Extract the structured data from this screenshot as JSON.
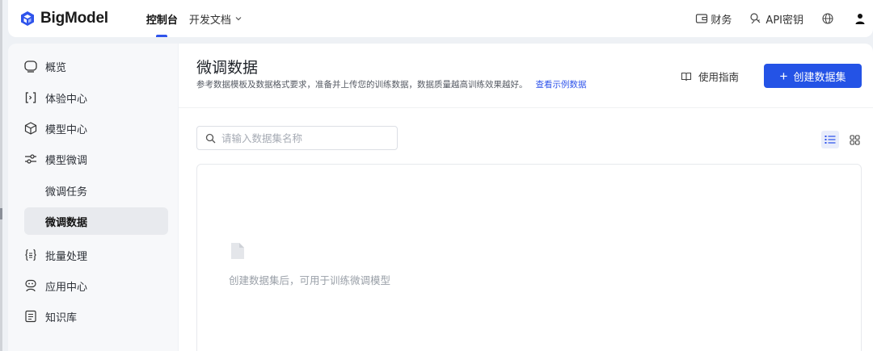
{
  "app": {
    "brand": "BigModel",
    "accent": "#2453e6"
  },
  "topnav": {
    "items": [
      {
        "label": "控制台",
        "active": true
      },
      {
        "label": "开发文档",
        "active": false,
        "dropdown": true
      }
    ],
    "right": {
      "finance": "财务",
      "apikey": "API密钥"
    }
  },
  "sidebar": {
    "items": [
      {
        "label": "概览",
        "icon": "chat-bubble-icon"
      },
      {
        "label": "体验中心",
        "icon": "bracket-icon"
      },
      {
        "label": "模型中心",
        "icon": "cube-icon"
      },
      {
        "label": "模型微调",
        "icon": "sliders-icon"
      },
      {
        "label": "批量处理",
        "icon": "braces-icon"
      },
      {
        "label": "应用中心",
        "icon": "robot-icon"
      },
      {
        "label": "知识库",
        "icon": "book-icon"
      }
    ],
    "subitems": [
      {
        "label": "微调任务",
        "active": false
      },
      {
        "label": "微调数据",
        "active": true
      }
    ]
  },
  "main": {
    "title": "微调数据",
    "description": "参考数据模板及数据格式要求，准备并上传您的训练数据，数据质量越高训练效果越好。",
    "example_link": "查看示例数据",
    "guide_label": "使用指南",
    "create_label": "创建数据集",
    "create_plus": "+",
    "search_placeholder": "请输入数据集名称",
    "empty_text": "创建数据集后，可用于训练微调模型",
    "view_mode": "list"
  }
}
